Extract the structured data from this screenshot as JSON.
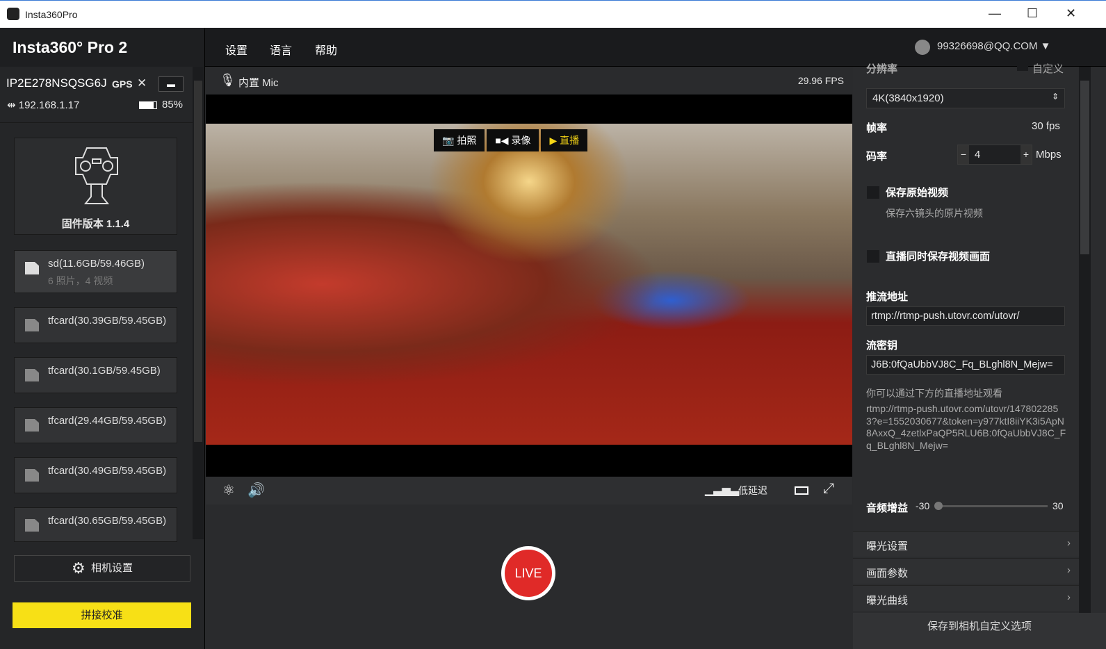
{
  "window": {
    "title": "Insta360Pro",
    "minimize": "—",
    "maximize": "☐",
    "close": "✕"
  },
  "header": {
    "brand": "Insta360° Pro 2",
    "menus": [
      "设置",
      "语言",
      "帮助"
    ],
    "user": "99326698@QQ.COM"
  },
  "device": {
    "id": "IP2E278NSQSG6J",
    "gps": "GPS",
    "gps_status": "✕",
    "ip": "192.168.1.17",
    "battery": "85%",
    "battery_level": 85,
    "firmware": "固件版本  1.1.4"
  },
  "storage": [
    {
      "name": "sd(11.6GB/59.46GB)",
      "sub": "6 照片，4 视频"
    },
    {
      "name": "tfcard(30.39GB/59.45GB)"
    },
    {
      "name": "tfcard(30.1GB/59.45GB)"
    },
    {
      "name": "tfcard(29.44GB/59.45GB)"
    },
    {
      "name": "tfcard(30.49GB/59.45GB)"
    },
    {
      "name": "tfcard(30.65GB/59.45GB)"
    }
  ],
  "sidebar": {
    "camera_settings": "相机设置",
    "stitch_calibration": "拼接校准"
  },
  "preview": {
    "mic": "内置 Mic",
    "fps": "29.96 FPS",
    "modes": [
      "拍照",
      "录像",
      "直播"
    ],
    "active_mode": "直播",
    "latency": "低延迟",
    "live": "LIVE"
  },
  "settings": {
    "resolution_label": "分辨率",
    "custom_label": "自定义",
    "resolution": "4K(3840x1920)",
    "framerate_label": "帧率",
    "framerate": "30  fps",
    "bitrate_label": "码率",
    "bitrate": "4",
    "bitrate_unit": "Mbps",
    "minus": "−",
    "plus": "+",
    "save_raw_label": "保存原始视频",
    "save_raw_desc": "保存六镜头的原片视频",
    "save_live_label": "直播同时保存视频画面",
    "push_url_label": "推流地址",
    "push_url": "rtmp://rtmp-push.utovr.com/utovr/",
    "stream_key_label": "流密钥",
    "stream_key": "J6B:0fQaUbbVJ8C_Fq_BLghl8N_Mejw=",
    "watch_hint": "你可以通过下方的直播地址观看",
    "watch_url": "rtmp://rtmp-push.utovr.com/utovr/1478022853?e=1552030677&token=y977ktI8iiYK3i5ApN8AxxQ_4zetlxPaQP5RLU6B:0fQaUbbVJ8C_Fq_BLghl8N_Mejw=",
    "audio_gain_label": "音频增益",
    "audio_min": "-30",
    "audio_max": "30",
    "audio_gain_value": -30,
    "sections": [
      "曝光设置",
      "画面参数",
      "曝光曲线"
    ],
    "save_button": "保存到相机自定义选项"
  }
}
